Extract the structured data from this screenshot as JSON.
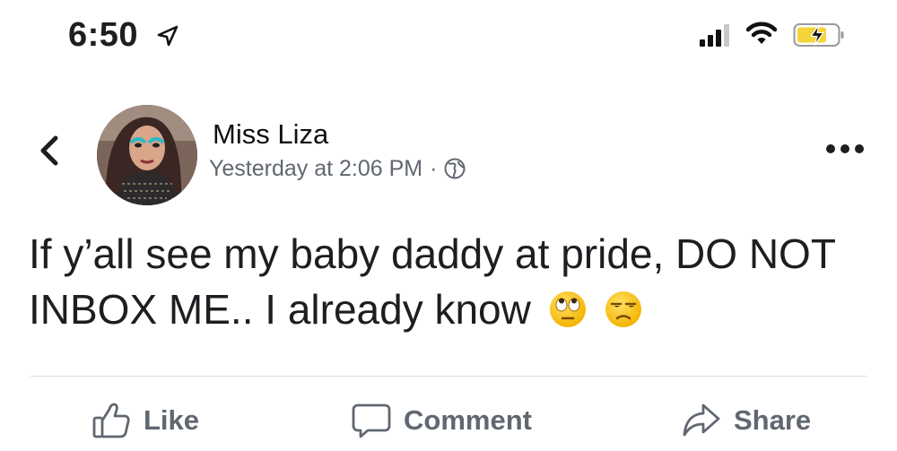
{
  "status_bar": {
    "time": "6:50",
    "location_icon": "location-arrow-icon",
    "signal_icon": "cellular-signal-icon",
    "wifi_icon": "wifi-icon",
    "battery_icon": "battery-charging-icon"
  },
  "post": {
    "author": "Miss Liza",
    "timestamp": "Yesterday at 2:06 PM",
    "separator": "·",
    "privacy_icon": "globe-icon",
    "text": "If y’all see my baby daddy at pride, DO NOT INBOX ME.. I already know",
    "emojis": [
      "face-with-rolling-eyes-emoji",
      "unamused-face-emoji"
    ]
  },
  "actions": {
    "like": "Like",
    "comment": "Comment",
    "share": "Share"
  },
  "colors": {
    "text_primary": "#1c1e21",
    "text_secondary": "#606770",
    "divider": "#d9dbde"
  }
}
